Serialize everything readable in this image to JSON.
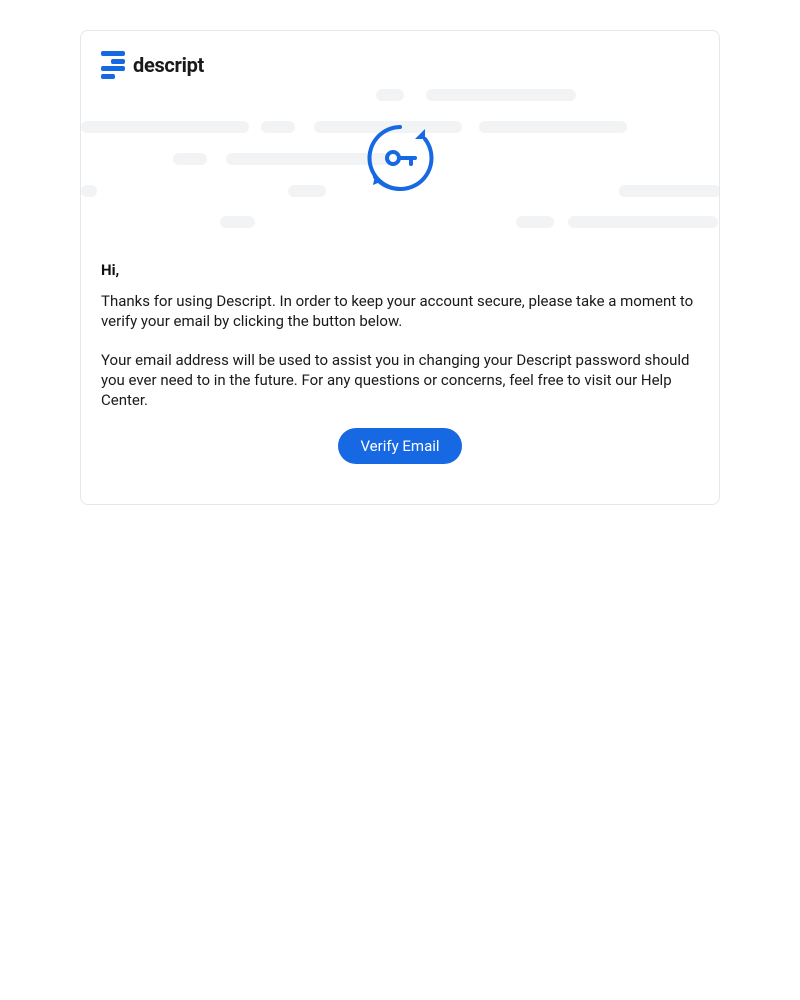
{
  "brand": {
    "logo_text": "descript",
    "primary_color": "#1668e3"
  },
  "email": {
    "greeting": "Hi,",
    "paragraph_1": "Thanks for using Descript. In order to keep your account secure, please take a moment to verify your email by clicking the button below.",
    "paragraph_2": "Your email address will be used to assist you in changing your Descript password should you ever need to in the future. For any questions or concerns, feel free to visit our Help Center.",
    "cta_label": "Verify Email"
  },
  "icons": {
    "hero": "key-refresh-icon"
  }
}
